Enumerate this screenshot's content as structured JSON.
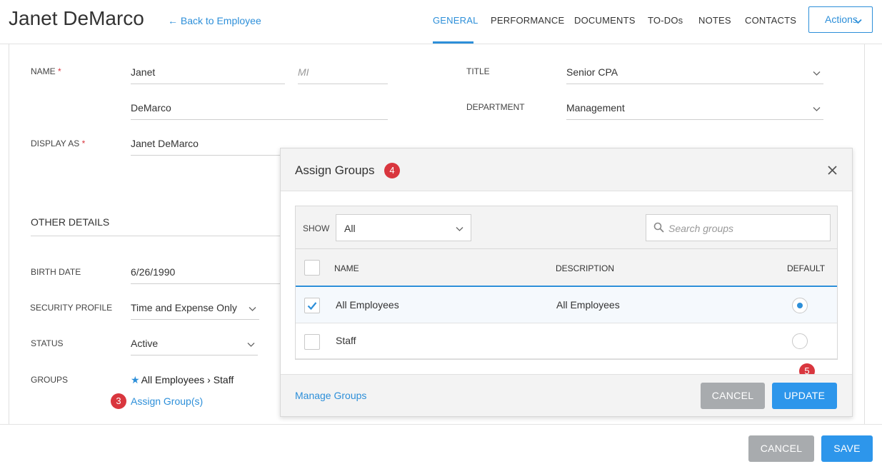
{
  "header": {
    "employee_name": "Janet DeMarco",
    "back_label": "Back to Employee",
    "tabs": [
      {
        "label": "GENERAL",
        "active": true
      },
      {
        "label": "PERFORMANCE",
        "active": false
      },
      {
        "label": "DOCUMENTS",
        "active": false
      },
      {
        "label": "TO-DOs",
        "active": false
      },
      {
        "label": "NOTES",
        "active": false
      },
      {
        "label": "CONTACTS",
        "active": false
      }
    ],
    "actions_label": "Actions"
  },
  "form": {
    "name_label": "NAME",
    "first_name": "Janet",
    "mi_placeholder": "MI",
    "last_name": "DeMarco",
    "display_as_label": "DISPLAY AS",
    "display_as": "Janet DeMarco",
    "title_label": "TITLE",
    "title": "Senior CPA",
    "department_label": "DEPARTMENT",
    "department": "Management",
    "required_mark": "*"
  },
  "other_details": {
    "section_title": "OTHER DETAILS",
    "birth_date_label": "BIRTH DATE",
    "birth_date": "6/26/1990",
    "security_profile_label": "SECURITY PROFILE",
    "security_profile": "Time and Expense Only",
    "status_label": "STATUS",
    "status": "Active",
    "groups_label": "GROUPS",
    "groups_value": "All Employees › Staff",
    "assign_link": "Assign Group(s)"
  },
  "markers": {
    "assign": "3",
    "modal": "4",
    "update": "5"
  },
  "modal": {
    "title": "Assign Groups",
    "show_label": "SHOW",
    "show_value": "All",
    "search_placeholder": "Search groups",
    "columns": {
      "name": "NAME",
      "description": "DESCRIPTION",
      "default": "DEFAULT"
    },
    "rows": [
      {
        "name": "All Employees",
        "description": "All Employees",
        "checked": true,
        "default": true
      },
      {
        "name": "Staff",
        "description": "",
        "checked": false,
        "default": false
      }
    ],
    "manage_link": "Manage Groups",
    "cancel_label": "CANCEL",
    "update_label": "UPDATE"
  },
  "footer": {
    "cancel_label": "CANCEL",
    "save_label": "SAVE"
  },
  "colors": {
    "accent": "#2d8fd9",
    "required": "#d9363e",
    "marker": "#d9363e",
    "button_grey": "#a8abae",
    "button_blue": "#2d96eb"
  },
  "icons": [
    "back-arrow-icon",
    "chevron-down-icon",
    "star-icon",
    "close-icon",
    "search-icon",
    "checkmark-icon"
  ]
}
